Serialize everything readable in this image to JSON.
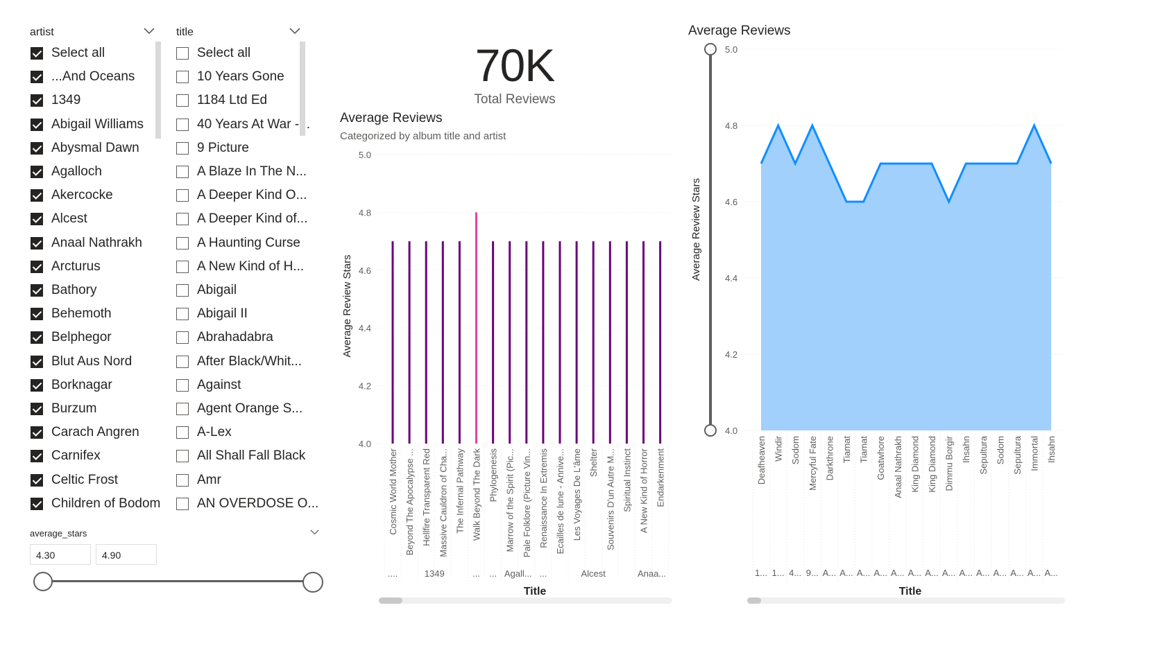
{
  "artist_slicer": {
    "header": "artist",
    "items": [
      {
        "label": "Select all",
        "checked": true
      },
      {
        "label": "...And Oceans",
        "checked": true
      },
      {
        "label": "1349",
        "checked": true
      },
      {
        "label": "Abigail Williams",
        "checked": true
      },
      {
        "label": "Abysmal Dawn",
        "checked": true
      },
      {
        "label": "Agalloch",
        "checked": true
      },
      {
        "label": "Akercocke",
        "checked": true
      },
      {
        "label": "Alcest",
        "checked": true
      },
      {
        "label": "Anaal Nathrakh",
        "checked": true
      },
      {
        "label": "Arcturus",
        "checked": true
      },
      {
        "label": "Bathory",
        "checked": true
      },
      {
        "label": "Behemoth",
        "checked": true
      },
      {
        "label": "Belphegor",
        "checked": true
      },
      {
        "label": "Blut Aus Nord",
        "checked": true
      },
      {
        "label": "Borknagar",
        "checked": true
      },
      {
        "label": "Burzum",
        "checked": true
      },
      {
        "label": "Carach Angren",
        "checked": true
      },
      {
        "label": "Carnifex",
        "checked": true
      },
      {
        "label": "Celtic Frost",
        "checked": true
      },
      {
        "label": "Children of Bodom",
        "checked": true
      }
    ]
  },
  "title_slicer": {
    "header": "title",
    "items": [
      {
        "label": "Select all",
        "checked": false
      },
      {
        "label": "10 Years Gone",
        "checked": false
      },
      {
        "label": "1184 Ltd Ed",
        "checked": false
      },
      {
        "label": "40 Years At War -...",
        "checked": false
      },
      {
        "label": "9 Picture",
        "checked": false
      },
      {
        "label": "A Blaze In The N...",
        "checked": false
      },
      {
        "label": "A Deeper Kind O...",
        "checked": false
      },
      {
        "label": "A Deeper Kind of...",
        "checked": false
      },
      {
        "label": "A Haunting Curse",
        "checked": false
      },
      {
        "label": "A New Kind of H...",
        "checked": false
      },
      {
        "label": "Abigail",
        "checked": false
      },
      {
        "label": "Abigail II",
        "checked": false
      },
      {
        "label": "Abrahadabra",
        "checked": false
      },
      {
        "label": "After Black/Whit...",
        "checked": false
      },
      {
        "label": "Against",
        "checked": false
      },
      {
        "label": "Agent Orange S...",
        "checked": false
      },
      {
        "label": "A-Lex",
        "checked": false
      },
      {
        "label": "All Shall Fall Black",
        "checked": false
      },
      {
        "label": "Amr",
        "checked": false
      },
      {
        "label": "AN OVERDOSE O...",
        "checked": false
      }
    ]
  },
  "stars_slicer": {
    "header": "average_stars",
    "min_value": "4.30",
    "max_value": "4.90"
  },
  "card": {
    "value": "70K",
    "label": "Total Reviews"
  },
  "colors": {
    "bar": "#6b007b",
    "bar_highlight": "#e044a7",
    "area_line": "#118dff",
    "area_fill": "#a0d0fb"
  },
  "chart_data": [
    {
      "type": "bar",
      "title": "Average Reviews",
      "subtitle": "Categorized by album title and artist",
      "xlabel": "Title",
      "ylabel": "Average Review Stars",
      "ylim": [
        4.0,
        5.0
      ],
      "yticks": [
        "4.0",
        "4.2",
        "4.4",
        "4.6",
        "4.8",
        "5.0"
      ],
      "grid": true,
      "categories": [
        "Cosmic World Mother",
        "Beyond The Apocalypse ...",
        "Hellfire Transparent Red",
        "Massive Cauldron of Cha...",
        "The Infernal Pathway",
        "Walk Beyond The Dark",
        "Phylogenesis",
        "Marrow of the Spirit (Pic...",
        "Pale Folklore (Picture Vin...",
        "Renaissance In Extremis",
        "Ecailles de lune - Annive...",
        "Les Voyages De L'âme",
        "Shelter",
        "Souvenirs D'un Autre M...",
        "Spiritual Instinct",
        "A New Kind of Horror",
        "Endarkenment"
      ],
      "values": [
        4.7,
        4.7,
        4.7,
        4.7,
        4.7,
        4.8,
        4.7,
        4.7,
        4.7,
        4.7,
        4.7,
        4.7,
        4.7,
        4.7,
        4.7,
        4.7,
        4.7
      ],
      "highlight_index": 5,
      "artist_groups": [
        {
          "label": "....",
          "span": [
            0,
            0
          ]
        },
        {
          "label": "1349",
          "span": [
            1,
            4
          ]
        },
        {
          "label": "...",
          "span": [
            5,
            5
          ]
        },
        {
          "label": "...",
          "span": [
            6,
            6
          ]
        },
        {
          "label": "Agall...",
          "span": [
            7,
            8
          ]
        },
        {
          "label": "...",
          "span": [
            9,
            9
          ]
        },
        {
          "label": "Alcest",
          "span": [
            10,
            14
          ]
        },
        {
          "label": "Anaa...",
          "span": [
            15,
            16
          ]
        }
      ]
    },
    {
      "type": "area",
      "title": "Average Reviews",
      "xlabel": "Title",
      "ylabel": "Average Review Stars",
      "ylim": [
        4.0,
        5.0
      ],
      "yticks": [
        "4.0",
        "4.2",
        "4.4",
        "4.6",
        "4.8",
        "5.0"
      ],
      "grid": true,
      "categories": [
        "Deafheaven",
        "Windir",
        "Sodom",
        "Mercyful Fate",
        "Darkthrone",
        "Tiamat",
        "Tiamat",
        "Goatwhore",
        "Anaal Nathrakh",
        "King Diamond",
        "King Diamond",
        "Dimmu Borgir",
        "Ihsahn",
        "Sepultura",
        "Sodom",
        "Sepultura",
        "Immortal",
        "Ihsahn"
      ],
      "values": [
        4.7,
        4.8,
        4.7,
        4.8,
        4.7,
        4.6,
        4.6,
        4.7,
        4.7,
        4.7,
        4.7,
        4.6,
        4.7,
        4.7,
        4.7,
        4.7,
        4.8,
        4.7
      ],
      "bottom_labels": [
        "1...",
        "1...",
        "4...",
        "9...",
        "A...",
        "A...",
        "A...",
        "A...",
        "A...",
        "A...",
        "A...",
        "A...",
        "A...",
        "A...",
        "A...",
        "A...",
        "A...",
        "A..."
      ]
    }
  ]
}
